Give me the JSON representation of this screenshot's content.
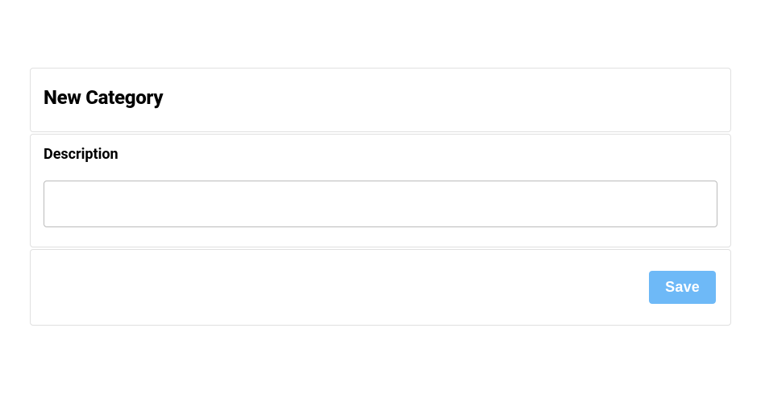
{
  "header": {
    "title": "New Category"
  },
  "form": {
    "description": {
      "label": "Description",
      "value": "",
      "placeholder": ""
    }
  },
  "footer": {
    "save_label": "Save"
  }
}
